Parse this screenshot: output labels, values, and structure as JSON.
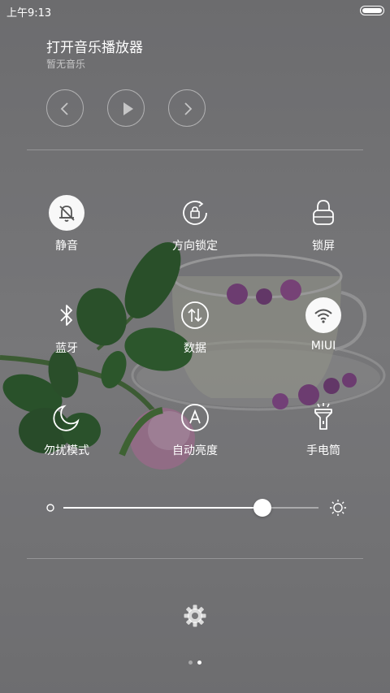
{
  "status_bar": {
    "time": "上午9:13"
  },
  "music": {
    "title": "打开音乐播放器",
    "subtitle": "暂无音乐",
    "controls": [
      "previous-icon",
      "play-icon",
      "next-icon"
    ]
  },
  "toggles": [
    {
      "label": "静音",
      "icon": "bell-mute-icon",
      "active": true
    },
    {
      "label": "方向锁定",
      "icon": "rotation-lock-icon",
      "active": false
    },
    {
      "label": "锁屏",
      "icon": "lock-icon",
      "active": false
    },
    {
      "label": "蓝牙",
      "icon": "bluetooth-icon",
      "active": false
    },
    {
      "label": "数据",
      "icon": "mobile-data-icon",
      "active": false
    },
    {
      "label": "MIUI",
      "icon": "wifi-icon",
      "active": true
    },
    {
      "label": "勿扰模式",
      "icon": "moon-icon",
      "active": false
    },
    {
      "label": "自动亮度",
      "icon": "auto-brightness-icon",
      "active": false
    },
    {
      "label": "手电筒",
      "icon": "flashlight-icon",
      "active": false
    }
  ],
  "brightness": {
    "level": 0.78,
    "min_icon": "brightness-low-icon",
    "max_icon": "brightness-high-icon"
  },
  "settings": {
    "icon": "gear-icon"
  },
  "pager": {
    "count": 2,
    "current": 2
  },
  "colors": {
    "overlay": "#5a5a5c",
    "accent": "#ffffff",
    "active_icon": "#555555"
  }
}
